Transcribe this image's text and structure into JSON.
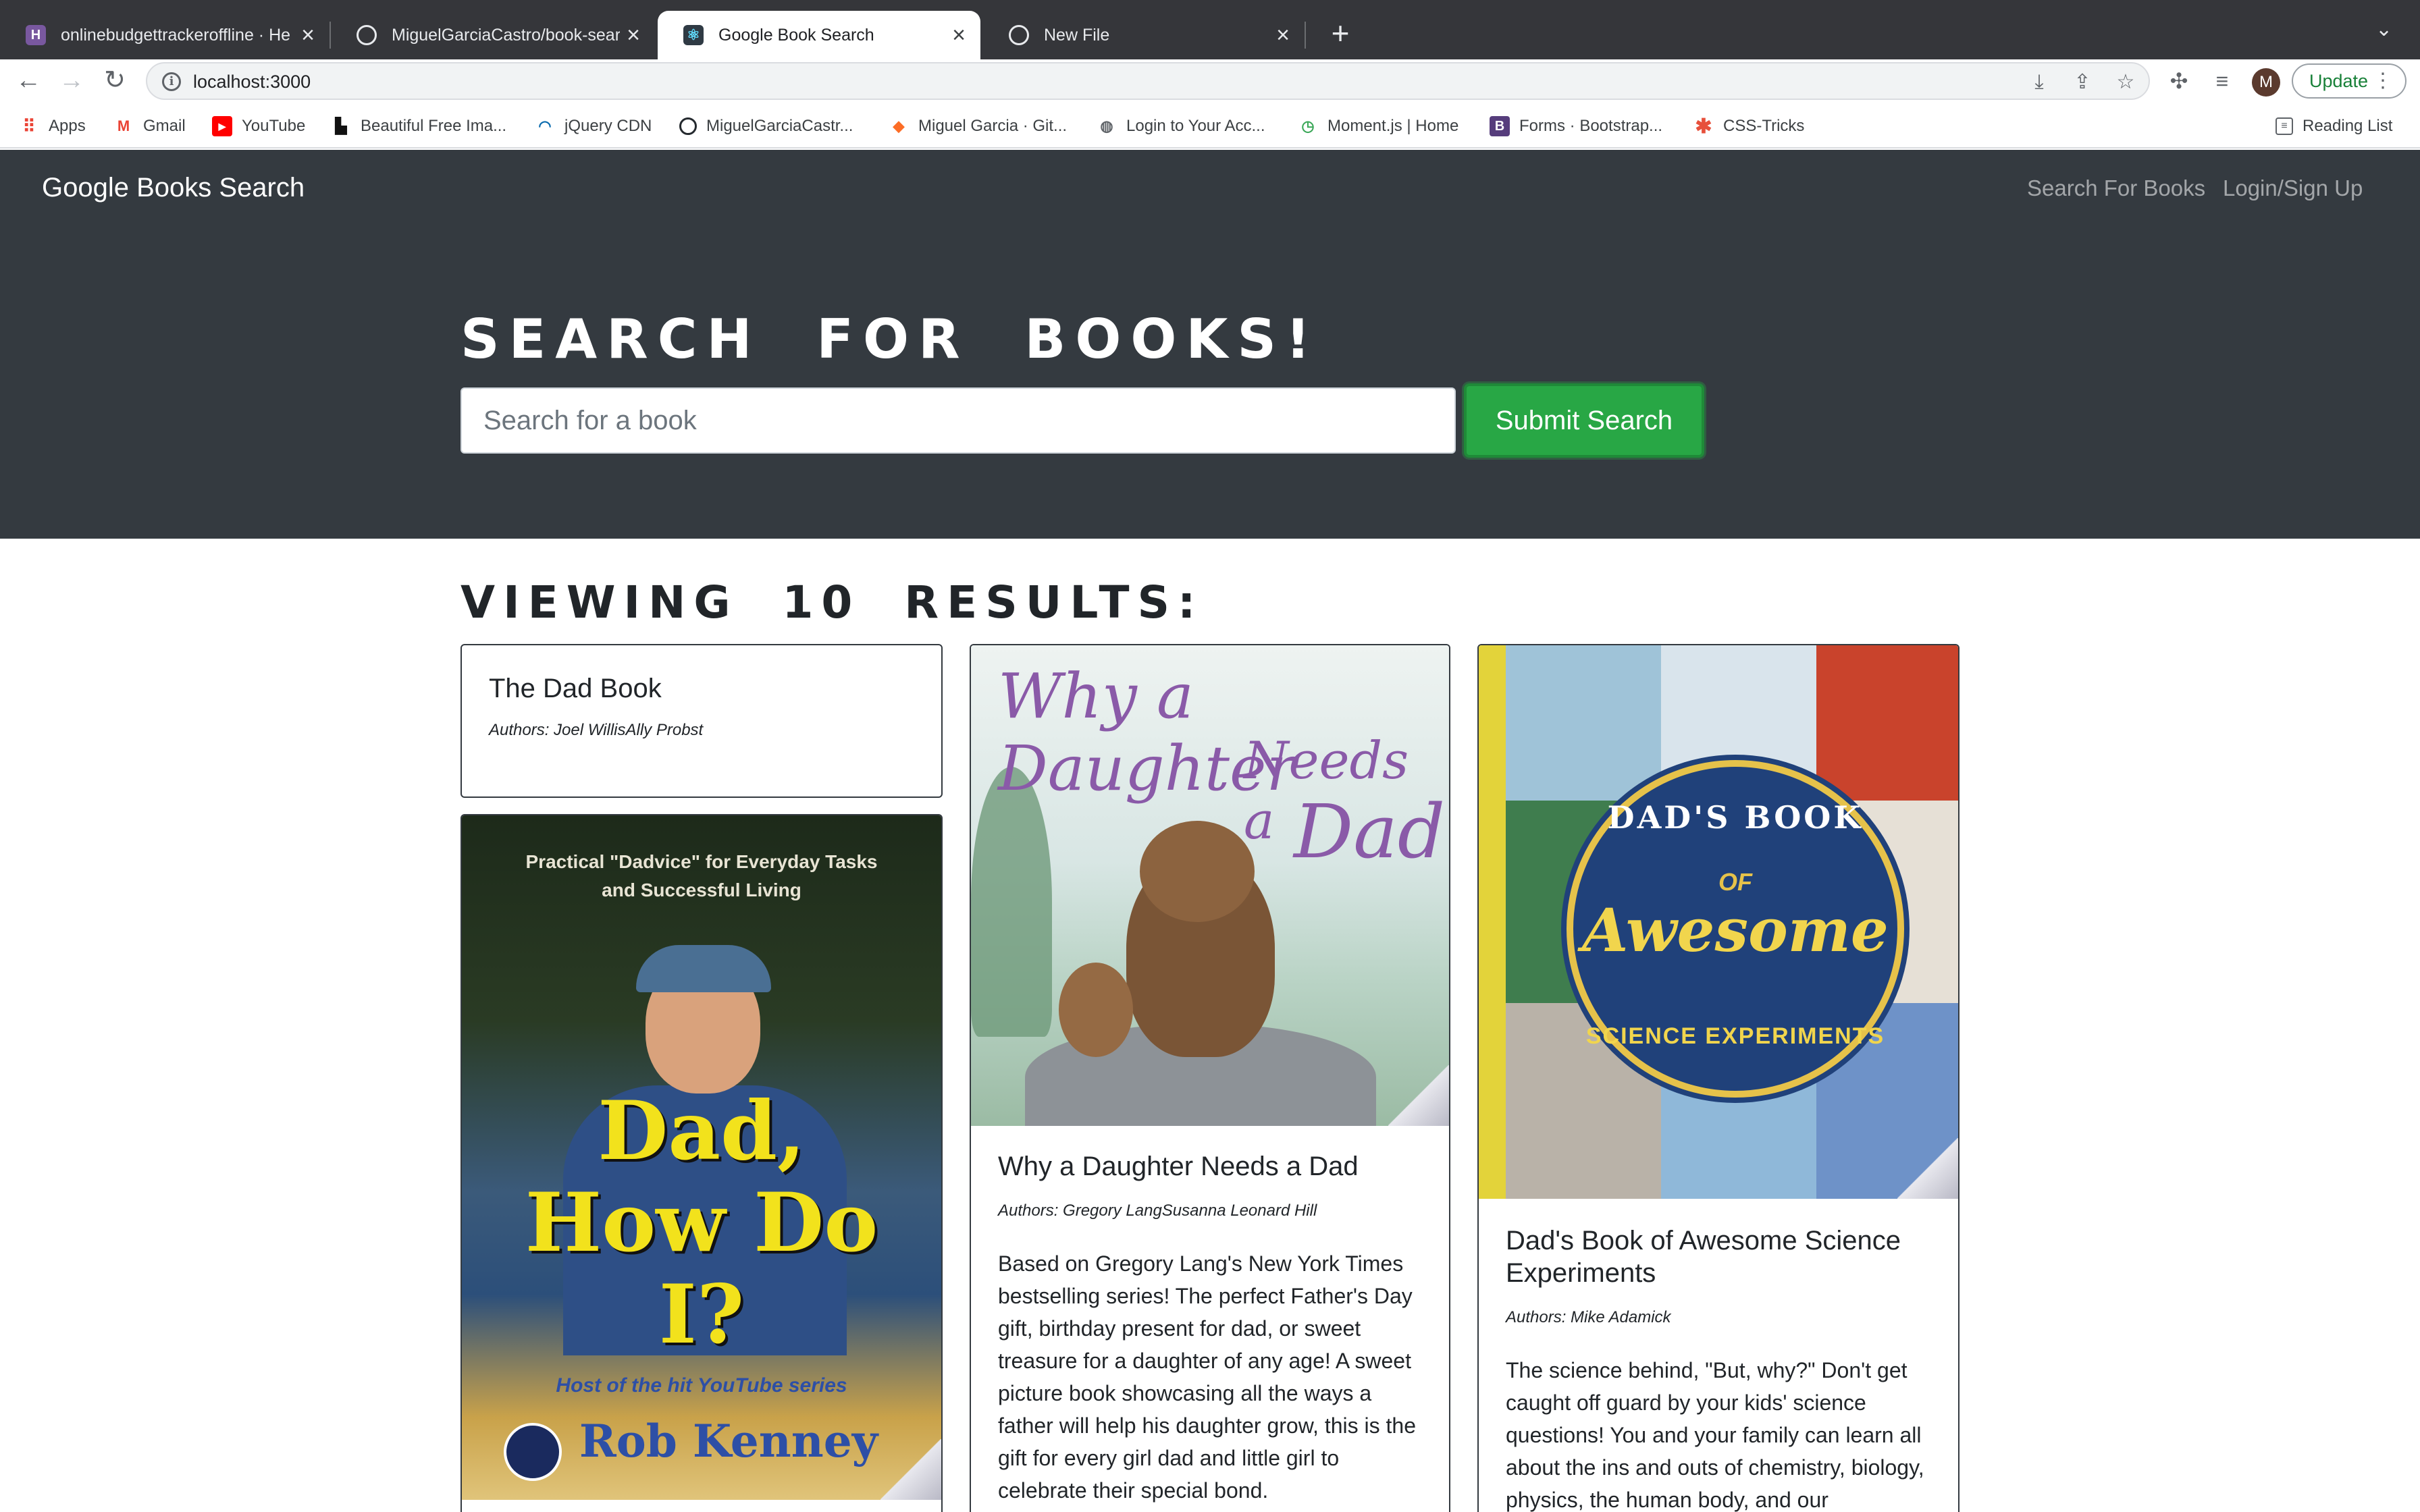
{
  "browser": {
    "tabs": [
      {
        "title": "onlinebudgettrackeroffline · He",
        "favicon": "heroku-icon",
        "active": false
      },
      {
        "title": "MiguelGarciaCastro/book-sear",
        "favicon": "github-icon",
        "active": false
      },
      {
        "title": "Google Book Search",
        "favicon": "react-icon",
        "active": true
      },
      {
        "title": "New File",
        "favicon": "github-icon",
        "active": false
      }
    ],
    "url": "localhost:3000",
    "update_label": "Update",
    "avatar_letter": "M",
    "bookmarks": [
      {
        "label": "Apps",
        "icon": "apps-grid-icon"
      },
      {
        "label": "Gmail",
        "icon": "gmail-icon"
      },
      {
        "label": "YouTube",
        "icon": "youtube-icon"
      },
      {
        "label": "Beautiful Free Ima...",
        "icon": "unsplash-icon"
      },
      {
        "label": "jQuery CDN",
        "icon": "jquery-icon"
      },
      {
        "label": "MiguelGarciaCastr...",
        "icon": "github-icon"
      },
      {
        "label": "Miguel Garcia · Git...",
        "icon": "gitlab-icon"
      },
      {
        "label": "Login to Your Acc...",
        "icon": "globe-icon"
      },
      {
        "label": "Moment.js | Home",
        "icon": "clock-icon"
      },
      {
        "label": "Forms · Bootstrap...",
        "icon": "bootstrap-icon"
      },
      {
        "label": "CSS-Tricks",
        "icon": "css-tricks-icon"
      }
    ],
    "reading_list": "Reading List"
  },
  "navbar": {
    "brand": "Google Books Search",
    "links": [
      "Search For Books",
      "Login/Sign Up"
    ]
  },
  "hero": {
    "title": "Search for Books!",
    "search_placeholder": "Search for a book",
    "search_value": "",
    "submit_label": "Submit Search"
  },
  "results": {
    "heading": "Viewing 10 results:",
    "cards": [
      {
        "title": "The Dad Book",
        "authors": "Authors: Joel WillisAlly Probst"
      },
      {
        "title": "Why a Daughter Needs a Dad",
        "authors": "Authors: Gregory LangSusanna Leonard Hill",
        "description": "Based on Gregory Lang's New York Times bestselling series! The perfect Father's Day gift, birthday present for dad, or sweet treasure for a daughter of any age! A sweet picture book showcasing all the ways a father will help his daughter grow, this is the gift for every girl dad and little girl to celebrate their special bond.",
        "cover_title_lines": [
          "Why a Daughter",
          "Needs a",
          "Dad"
        ]
      },
      {
        "title": "Dad's Book of Awesome Science Experiments",
        "authors": "Authors: Mike Adamick",
        "description": "The science behind, \"But, why?\" Don't get caught off guard by your kids' science questions! You and your family can learn all about the ins and outs of chemistry, biology, physics, the human body, and our",
        "cover_badge_top": "DAD'S BOOK",
        "cover_badge_of": "OF",
        "cover_badge_main": "Awesome",
        "cover_badge_bottom": "SCIENCE EXPERIMENTS"
      },
      {
        "title": "Dad, How Do I?",
        "cover_tagline": "Practical \"Dadvice\" for Everyday Tasks and Successful Living",
        "cover_title": "Dad, How Do I?",
        "cover_host": "Host of the hit YouTube series",
        "cover_author": "Rob Kenney"
      }
    ]
  }
}
